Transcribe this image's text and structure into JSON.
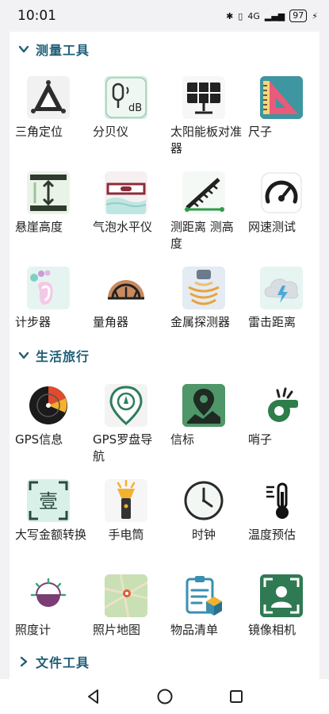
{
  "status": {
    "time": "10:01",
    "network": "4G",
    "battery": "97"
  },
  "sections": [
    {
      "title": "测量工具",
      "expanded": true
    },
    {
      "title": "生活旅行",
      "expanded": true
    },
    {
      "title": "文件工具",
      "expanded": false
    }
  ],
  "measure_tools": [
    {
      "label": "三角定位",
      "icon": "triangle-locate-icon"
    },
    {
      "label": "分贝仪",
      "icon": "decibel-meter-icon"
    },
    {
      "label": "太阳能板对准器",
      "icon": "solar-panel-icon"
    },
    {
      "label": "尺子",
      "icon": "ruler-icon"
    },
    {
      "label": "悬崖高度",
      "icon": "cliff-height-icon"
    },
    {
      "label": "气泡水平仪",
      "icon": "bubble-level-icon"
    },
    {
      "label": "测距离 测高度",
      "icon": "distance-height-icon"
    },
    {
      "label": "网速测试",
      "icon": "speedometer-icon"
    },
    {
      "label": "计步器",
      "icon": "footprint-icon"
    },
    {
      "label": "量角器",
      "icon": "protractor-icon"
    },
    {
      "label": "金属探测器",
      "icon": "metal-detector-icon"
    },
    {
      "label": "雷击距离",
      "icon": "lightning-cloud-icon"
    }
  ],
  "life_tools": [
    {
      "label": "GPS信息",
      "icon": "gps-radar-icon"
    },
    {
      "label": "GPS罗盘导航",
      "icon": "compass-pin-icon"
    },
    {
      "label": "信标",
      "icon": "map-pin-icon"
    },
    {
      "label": "哨子",
      "icon": "whistle-icon"
    },
    {
      "label": "大写金额转换",
      "icon": "amount-convert-icon",
      "glyph": "壹"
    },
    {
      "label": "手电筒",
      "icon": "flashlight-icon"
    },
    {
      "label": "时钟",
      "icon": "clock-icon"
    },
    {
      "label": "温度预估",
      "icon": "thermometer-icon"
    },
    {
      "label": "照度计",
      "icon": "lux-meter-icon"
    },
    {
      "label": "照片地图",
      "icon": "photo-map-icon"
    },
    {
      "label": "物品清单",
      "icon": "checklist-icon"
    },
    {
      "label": "镜像相机",
      "icon": "mirror-camera-icon"
    }
  ]
}
